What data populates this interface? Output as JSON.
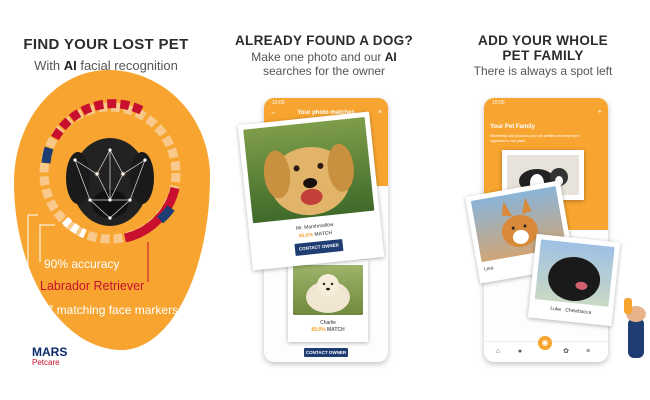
{
  "panel1": {
    "title": "FIND YOUR LOST PET",
    "subtitle_prefix": "With ",
    "subtitle_bold": "AI",
    "subtitle_suffix": " facial recognition",
    "stats": [
      "90% accuracy",
      "Labrador Retriever",
      "17 matching face markers"
    ],
    "logo": "MARS",
    "logo_sub": "Petcare"
  },
  "panel2": {
    "title": "ALREADY FOUND A DOG?",
    "subtitle_line1_prefix": "Make one photo and our ",
    "subtitle_line1_bold": "AI",
    "subtitle_line2": "searches for the owner",
    "phone": {
      "time": "10:00",
      "header": "Your photo matches",
      "cards": [
        {
          "name": "Mr. Marshmallow",
          "percent": "95.6%",
          "match_label": "MATCH",
          "button": "CONTACT OWNER"
        },
        {
          "name": "Charlie",
          "percent": "89.8%",
          "match_label": "MATCH",
          "button": "CONTACT OWNER"
        }
      ]
    }
  },
  "panel3": {
    "title_line1": "ADD YOUR WHOLE",
    "title_line2": "PET FAMILY",
    "subtitle": "There is always a spot left",
    "phone": {
      "time": "10:00",
      "header": "Your Pet Family",
      "desc": "Effortlessly add photos to your pet profiles and keep them organized in one place.",
      "card_labels": [
        "Leia",
        "Luke",
        "Chewbacca"
      ]
    }
  },
  "colors": {
    "orange": "#f7a530",
    "navy": "#1f3c73",
    "red": "#c8102e"
  }
}
